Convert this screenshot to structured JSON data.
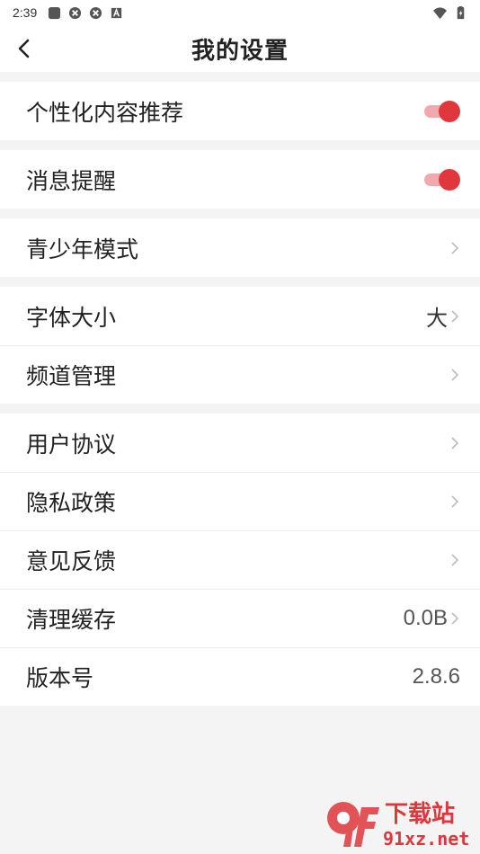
{
  "status_bar": {
    "time": "2:39",
    "left_icons": [
      "app-notification-icon",
      "circle-app-icon",
      "circle-app-icon-2",
      "a-box-icon"
    ],
    "right_icons": [
      "wifi-icon",
      "battery-icon"
    ]
  },
  "header": {
    "title": "我的设置",
    "back_icon": "chevron-left-icon"
  },
  "groups": {
    "g1": {
      "recommend": {
        "label": "个性化内容推荐",
        "toggle_on": true
      }
    },
    "g2": {
      "notify": {
        "label": "消息提醒",
        "toggle_on": true
      }
    },
    "g3": {
      "youth": {
        "label": "青少年模式"
      }
    },
    "g4": {
      "font_size": {
        "label": "字体大小",
        "value": "大"
      },
      "channel": {
        "label": "频道管理"
      }
    },
    "g5": {
      "agreement": {
        "label": "用户协议"
      },
      "privacy": {
        "label": "隐私政策"
      },
      "feedback": {
        "label": "意见反馈"
      },
      "cache": {
        "label": "清理缓存",
        "value": "0.0B"
      },
      "version": {
        "label": "版本号",
        "value": "2.8.6"
      }
    }
  },
  "watermark": {
    "logo": "9f",
    "line1": "下载站",
    "line2": "91xz.net"
  },
  "colors": {
    "accent": "#e0373c",
    "accent_track": "#f1a9ad",
    "background": "#f4f4f5"
  }
}
